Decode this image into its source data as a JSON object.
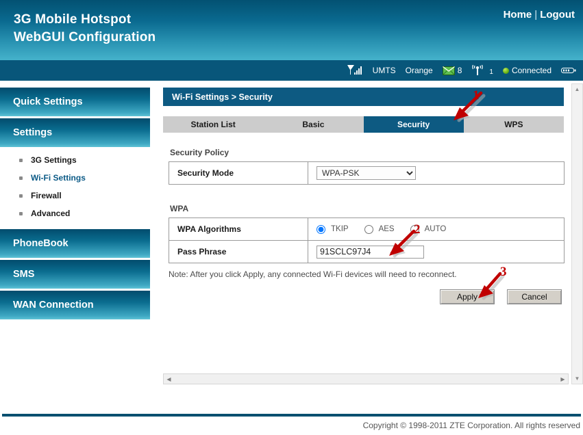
{
  "header": {
    "title_line1": "3G Mobile Hotspot",
    "title_line2": "WebGUI Configuration",
    "home_label": "Home",
    "separator": "|",
    "logout_label": "Logout"
  },
  "statusbar": {
    "signal_icon": "signal-bars-icon",
    "network_type": "UMTS",
    "carrier": "Orange",
    "mail_icon": "envelope-icon",
    "mail_count": "8",
    "wifi_icon": "wifi-broadcast-icon",
    "wifi_clients": "1",
    "connection_status": "Connected",
    "battery_icon": "battery-icon"
  },
  "sidebar": {
    "sections": [
      {
        "label": "Quick Settings"
      },
      {
        "label": "Settings"
      },
      {
        "label": "PhoneBook"
      },
      {
        "label": "SMS"
      },
      {
        "label": "WAN Connection"
      }
    ],
    "settings_subitems": [
      {
        "label": "3G Settings",
        "active": false
      },
      {
        "label": "Wi-Fi Settings",
        "active": true
      },
      {
        "label": "Firewall",
        "active": false
      },
      {
        "label": "Advanced",
        "active": false
      }
    ]
  },
  "main": {
    "breadcrumb": "Wi-Fi Settings > Security",
    "tabs": [
      {
        "label": "Station List",
        "active": false
      },
      {
        "label": "Basic",
        "active": false
      },
      {
        "label": "Security",
        "active": true
      },
      {
        "label": "WPS",
        "active": false
      }
    ],
    "security_policy": {
      "section_title": "Security Policy",
      "security_mode_label": "Security Mode",
      "security_mode_value": "WPA-PSK",
      "security_mode_options": [
        "WPA-PSK"
      ]
    },
    "wpa": {
      "section_title": "WPA",
      "algorithms_label": "WPA Algorithms",
      "algorithms": [
        {
          "label": "TKIP",
          "selected": true
        },
        {
          "label": "AES",
          "selected": false
        },
        {
          "label": "AUTO",
          "selected": false
        }
      ],
      "passphrase_label": "Pass Phrase",
      "passphrase_value": "91SCLC97J4"
    },
    "note": "Note: After you click Apply, any connected Wi-Fi devices will need to reconnect.",
    "apply_label": "Apply",
    "cancel_label": "Cancel"
  },
  "annotations": [
    {
      "number": "1",
      "target": "security-tab"
    },
    {
      "number": "2",
      "target": "passphrase-field"
    },
    {
      "number": "3",
      "target": "apply-button"
    }
  ],
  "scrollbars": {
    "h_left_arrow": "◀",
    "h_right_arrow": "▶",
    "v_up_arrow": "▲",
    "v_down_arrow": "▼"
  },
  "footer": {
    "copyright": "Copyright © 1998-2011 ZTE Corporation. All rights reserved"
  },
  "colors": {
    "header_top": "#035172",
    "header_bottom": "#45b2cb",
    "statusbar": "#08567a",
    "accent_blue": "#0d5a82",
    "tab_inactive": "#cccccc",
    "annotation_red": "#c00000",
    "link_blue": "#0b5a86"
  }
}
